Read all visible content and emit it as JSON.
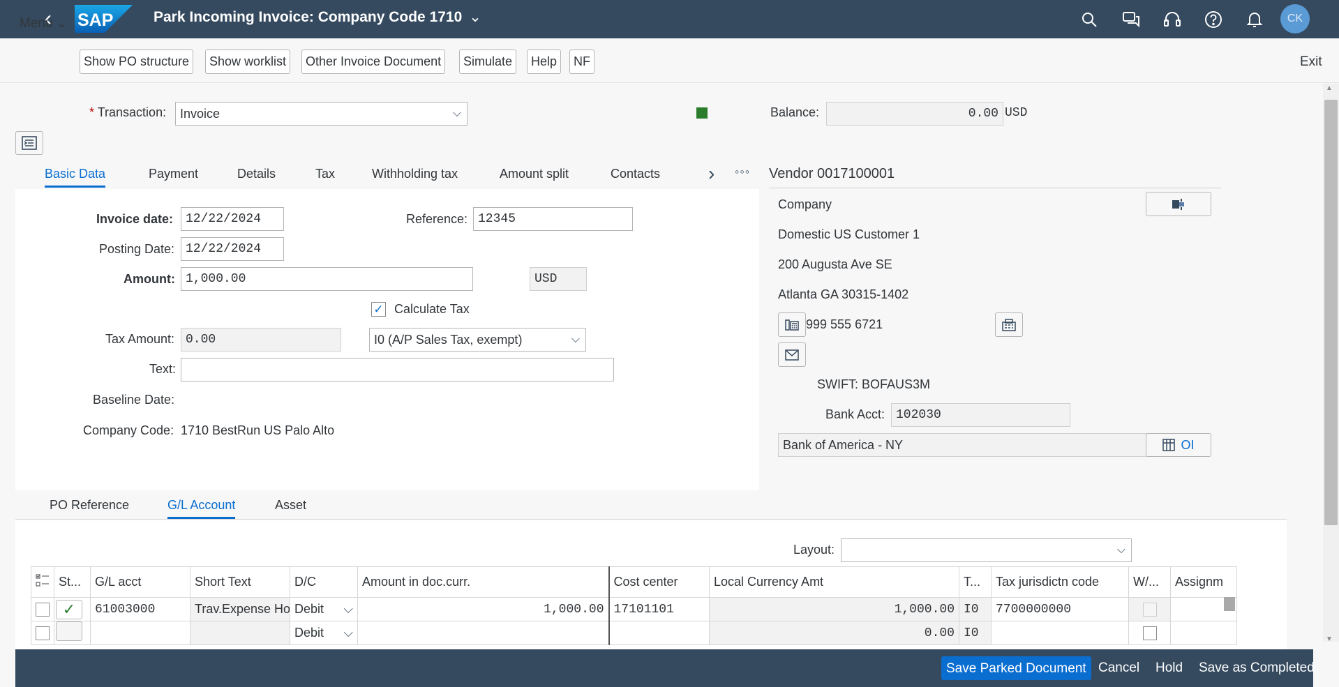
{
  "shell": {
    "title": "Park Incoming Invoice: Company Code 1710",
    "logo_text": "SAP",
    "avatar": "CK"
  },
  "toolbar": {
    "menu": "Menu",
    "buttons": [
      "Show PO structure",
      "Show worklist",
      "Other Invoice Document",
      "Simulate",
      "Help",
      "NF"
    ],
    "exit": "Exit"
  },
  "header": {
    "transaction_label": "Transaction:",
    "transaction_value": "Invoice",
    "balance_label": "Balance:",
    "balance_value": "0.00",
    "balance_currency": "USD",
    "status_color": "#2b7d2b"
  },
  "tabs": [
    "Basic Data",
    "Payment",
    "Details",
    "Tax",
    "Withholding tax",
    "Amount split",
    "Contacts"
  ],
  "basic": {
    "invoice_date_label": "Invoice date:",
    "invoice_date": "12/22/2024",
    "reference_label": "Reference:",
    "reference": "12345",
    "posting_date_label": "Posting Date:",
    "posting_date": "12/22/2024",
    "amount_label": "Amount:",
    "amount": "1,000.00",
    "currency": "USD",
    "calc_tax": "Calculate Tax",
    "tax_amount_label": "Tax Amount:",
    "tax_amount": "0.00",
    "tax_code": "I0 (A/P Sales Tax, exempt)",
    "text_label": "Text:",
    "text": "",
    "baseline_label": "Baseline Date:",
    "company_code_label": "Company Code:",
    "company_code": "1710 BestRun US Palo Alto"
  },
  "vendor": {
    "title": "Vendor 0017100001",
    "line1": "Company",
    "line2": "Domestic US Customer 1",
    "line3": "200 Augusta Ave SE",
    "line4": "Atlanta GA  30315-1402",
    "phone": "999 555 6721",
    "swift": "SWIFT: BOFAUS3M",
    "bank_acct_label": "Bank Acct:",
    "bank_acct": "102030",
    "bank_name": "Bank of America - NY",
    "oi_button": "OI"
  },
  "lower_tabs": [
    "PO Reference",
    "G/L Account",
    "Asset"
  ],
  "layout": {
    "label": "Layout:",
    "value": ""
  },
  "grid": {
    "columns": [
      "St...",
      "G/L acct",
      "Short Text",
      "D/C",
      "Amount in doc.curr.",
      "Cost center",
      "Local Currency Amt",
      "T...",
      "Tax jurisdictn code",
      "W/...",
      "Assignm"
    ],
    "rows": [
      {
        "gl": "61003000",
        "short": "Trav.Expense Hotel",
        "dc": "Debit",
        "amount": "1,000.00",
        "cc": "17101101",
        "local": "1,000.00",
        "tax": "I0",
        "juris": "7700000000"
      },
      {
        "gl": "",
        "short": "",
        "dc": "Debit",
        "amount": "",
        "cc": "",
        "local": "0.00",
        "tax": "I0",
        "juris": ""
      }
    ]
  },
  "footer": {
    "save_parked": "Save Parked Document",
    "cancel": "Cancel",
    "hold": "Hold",
    "save_completed": "Save as Completed"
  }
}
